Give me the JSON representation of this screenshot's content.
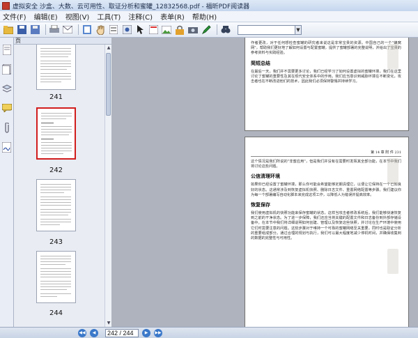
{
  "window": {
    "title": "虚拟安全 沙盒、大数、云可用性、取证分析和蜜罐_12832568.pdf - 福昕PDF阅读器"
  },
  "menu": [
    "文件(F)",
    "编辑(E)",
    "视图(V)",
    "工具(T)",
    "注释(C)",
    "表单(R)",
    "帮助(H)"
  ],
  "toolbar": {
    "search_value": ""
  },
  "panel": {
    "tab_label": "页"
  },
  "thumbnails": [
    {
      "page": "241",
      "selected": false
    },
    {
      "page": "242",
      "selected": true
    },
    {
      "page": "243",
      "selected": false
    },
    {
      "page": "244",
      "selected": false
    }
  ],
  "doc": {
    "top_text_1": "作者更改，对于任何想检查蜜罐的研究者来说这是非常宝贵的资源。中国自己的一个\"蜂窝网\"，帮助我们更好地了解如何设置与配置蜜罐，提供了蜜罐部署的完整说明，并给出了宝贵的参考资料与实践经验。",
    "top_heading": "简短总结",
    "top_text_2": "在最后一天，我们并不需要更多讨论，我们已经学习了如何设置虚拟的蜜罐环境，我们在这里讨论了蜜罐的重要性及其在现代安全体系中的作用。我们应当意识到威胁环境在不断变化，攻击者也在不断改进他们的技术，因此我们必须保持警惕并持续学习。",
    "running_head": "第 14 章   附 件   231",
    "bot_text_1": "这个情况是我们所说的\"非蜜应用\"，但是我们并没有在需要时发挥其全部功能，在本节中我们将讨论这些问题。",
    "bot_heading_1": "公信清理环境",
    "bot_text_2": "如果你已经设置了蜜罐环境，那么你可能会希望能够定期清理它，以便让它保持在一个已知良好的状态。这通常涉及到恢复虚拟机快照、删除日志文件、重置网络配置等步骤。我们建议你为每一个部署编写自动化脚本来完成这项工作，以降低人为错误并提高效率。",
    "bot_heading_2": "恢复保存",
    "bot_text_3": "我们使用虚拟机的快照功能来保存蜜罐的状态，这样当攻击者修改系统后，我们能够快速恢复到之前的干净状态。为了进一步保障，我们还应当将关键的配置文件和日志备份到外部存储设备中。在本节中我们将详细说明如何创建、管理以及恢复这些快照，并讨论在生产环境中使用它们时需要注意的问题。这些步骤对于维持一个可靠的蜜罐网络至关重要，同时也是取证分析的重要组成部分。通过合理的规划与执行，我们可以最大程度地减少停机时间，并确保收集到的数据的完整性与可用性。"
  },
  "status": {
    "page_field": "242 / 244"
  }
}
